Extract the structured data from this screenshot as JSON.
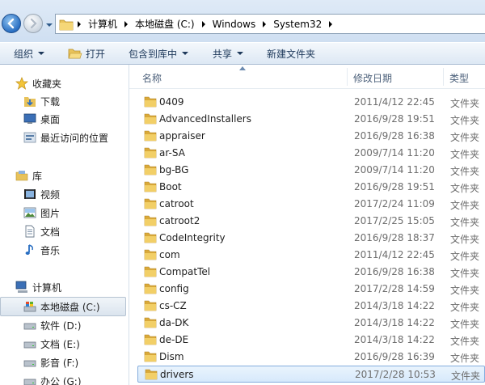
{
  "address": {
    "crumbs": [
      "计算机",
      "本地磁盘 (C:)",
      "Windows",
      "System32"
    ]
  },
  "toolbar": {
    "organize": "组织",
    "open": "打开",
    "include_in_library": "包含到库中",
    "share": "共享",
    "new_folder": "新建文件夹"
  },
  "nav": {
    "favorites": "收藏夹",
    "downloads": "下载",
    "desktop": "桌面",
    "recent": "最近访问的位置",
    "libraries": "库",
    "videos": "视频",
    "pictures": "图片",
    "documents": "文档",
    "music": "音乐",
    "computer": "计算机",
    "drive_c": "本地磁盘 (C:)",
    "drive_d": "软件 (D:)",
    "drive_e": "文档 (E:)",
    "drive_f": "影音 (F:)",
    "drive_g": "办公 (G:)"
  },
  "columns": {
    "name": "名称",
    "modified": "修改日期",
    "type": "类型"
  },
  "files": [
    {
      "name": "0409",
      "date": "2011/4/12 22:45",
      "type": "文件夹"
    },
    {
      "name": "AdvancedInstallers",
      "date": "2016/9/28 19:51",
      "type": "文件夹"
    },
    {
      "name": "appraiser",
      "date": "2016/9/28 16:38",
      "type": "文件夹"
    },
    {
      "name": "ar-SA",
      "date": "2009/7/14 11:20",
      "type": "文件夹"
    },
    {
      "name": "bg-BG",
      "date": "2009/7/14 11:20",
      "type": "文件夹"
    },
    {
      "name": "Boot",
      "date": "2016/9/28 19:51",
      "type": "文件夹"
    },
    {
      "name": "catroot",
      "date": "2017/2/24 11:09",
      "type": "文件夹"
    },
    {
      "name": "catroot2",
      "date": "2017/2/25 15:05",
      "type": "文件夹"
    },
    {
      "name": "CodeIntegrity",
      "date": "2016/9/28 18:37",
      "type": "文件夹"
    },
    {
      "name": "com",
      "date": "2011/4/12 22:45",
      "type": "文件夹"
    },
    {
      "name": "CompatTel",
      "date": "2016/9/28 16:38",
      "type": "文件夹"
    },
    {
      "name": "config",
      "date": "2017/2/28 14:59",
      "type": "文件夹"
    },
    {
      "name": "cs-CZ",
      "date": "2014/3/18 14:22",
      "type": "文件夹"
    },
    {
      "name": "da-DK",
      "date": "2014/3/18 14:22",
      "type": "文件夹"
    },
    {
      "name": "de-DE",
      "date": "2014/3/18 14:22",
      "type": "文件夹"
    },
    {
      "name": "Dism",
      "date": "2016/9/28 16:39",
      "type": "文件夹"
    },
    {
      "name": "drivers",
      "date": "2017/2/28 10:53",
      "type": "文件夹"
    }
  ]
}
